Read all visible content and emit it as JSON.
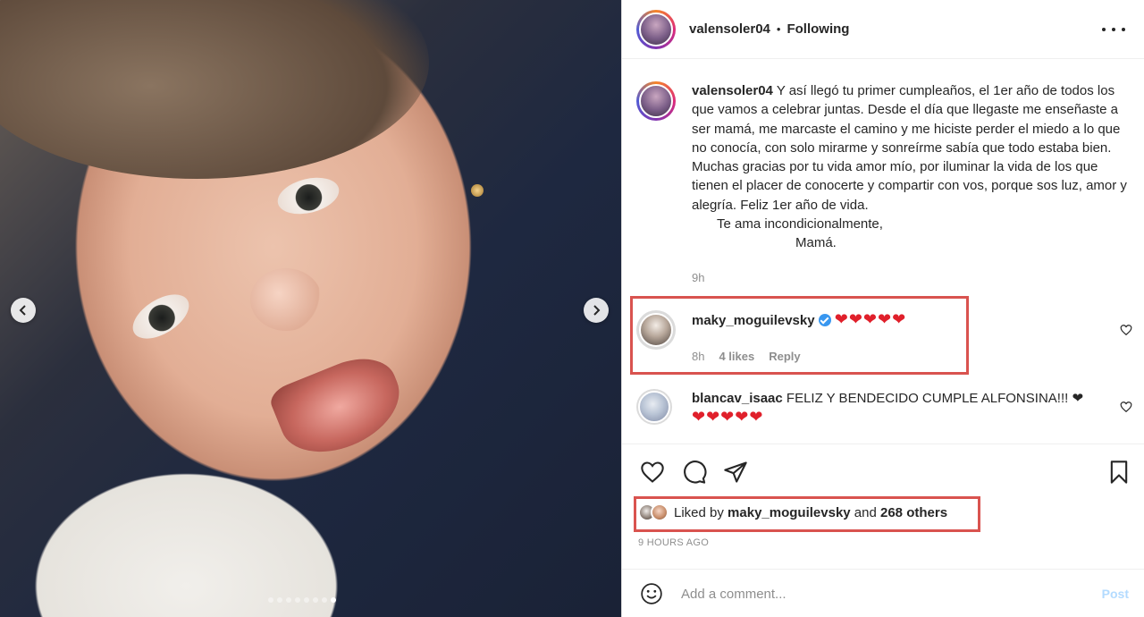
{
  "post": {
    "username": "valensoler04",
    "separator": "•",
    "follow_status": "Following",
    "more_icon": "more-options-icon"
  },
  "caption": {
    "username": "valensoler04",
    "body": "Y así llegó tu primer cumpleaños, el 1er año de todos los que vamos a celebrar juntas. Desde el día que llegaste me enseñaste a ser mamá, me marcaste el camino y me hiciste perder el miedo a lo que no conocía, con solo mirarme y sonreírme sabía que todo estaba bien. Muchas gracias por tu vida amor mío, por iluminar la vida de los que tienen el placer de conocerte y compartir con vos, porque sos luz, amor y alegría. Feliz 1er año de vida.",
    "sign_line1": "Te ama incondicionalmente,",
    "sign_line2": "Mamá.",
    "time": "9h"
  },
  "comments": [
    {
      "username": "maky_moguilevsky",
      "verified": true,
      "text": "❤❤❤❤❤",
      "time": "8h",
      "likes": "4 likes",
      "reply": "Reply"
    },
    {
      "username": "blancav_isaac",
      "verified": false,
      "text": "FELIZ Y BENDECIDO CUMPLE ALFONSINA!!! ❤",
      "text_line2": "❤❤❤❤❤"
    }
  ],
  "likes": {
    "prefix": "Liked by",
    "user": "maky_moguilevsky",
    "conjunction": "and",
    "others": "268 others"
  },
  "timestamp": "9 HOURS AGO",
  "composer": {
    "placeholder": "Add a comment...",
    "post_label": "Post"
  },
  "carousel": {
    "slide_count": 8,
    "active_index": 7
  },
  "colors": {
    "highlight": "#d9534f",
    "heart": "#e0202b",
    "verified": "#3897f0",
    "post_disabled": "#b3dbff"
  }
}
